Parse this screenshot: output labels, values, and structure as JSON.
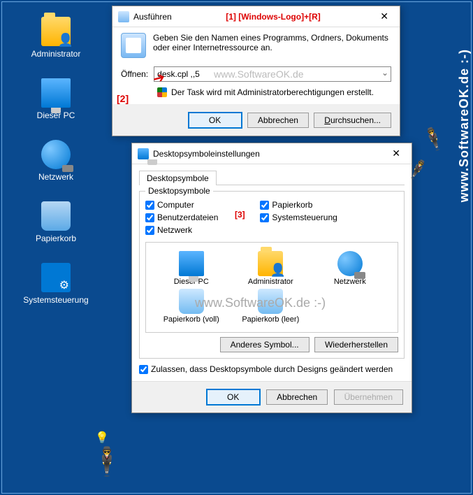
{
  "desktop": {
    "icons": [
      {
        "label": "Administrator",
        "ic": "ic-folder"
      },
      {
        "label": "Dieser PC",
        "ic": "ic-pc"
      },
      {
        "label": "Netzwerk",
        "ic": "ic-net"
      },
      {
        "label": "Papierkorb",
        "ic": "ic-bin"
      },
      {
        "label": "Systemsteuerung",
        "ic": "ic-ctrl"
      }
    ]
  },
  "run": {
    "title": "Ausführen",
    "annot1": "[1] [Windows-Logo]+[R]",
    "desc": "Geben Sie den Namen eines Programms, Ordners, Dokuments oder einer Internetressource an.",
    "open_label": "Öffnen:",
    "command": "desk.cpl ,,5",
    "input_wm": "www.SoftwareOK.de",
    "admin_note": "Der Task wird mit Administratorberechtigungen erstellt.",
    "annot2": "[2]",
    "ok": "OK",
    "cancel": "Abbrechen",
    "browse": "Durchsuchen..."
  },
  "settings": {
    "title": "Desktopsymboleinstellungen",
    "tab": "Desktopsymbole",
    "group_title": "Desktopsymbole",
    "annot3": "[3]",
    "checks_left": [
      "Computer",
      "Benutzerdateien",
      "Netzwerk"
    ],
    "checks_right": [
      "Papierkorb",
      "Systemsteuerung"
    ],
    "preview": [
      {
        "label": "Dieser PC",
        "ic": "ic-pc"
      },
      {
        "label": "Administrator",
        "ic": "ic-folder"
      },
      {
        "label": "Netzwerk",
        "ic": "ic-net"
      },
      {
        "label": "Papierkorb (voll)",
        "ic": "ic-bin"
      },
      {
        "label": "Papierkorb (leer)",
        "ic": "ic-bin"
      }
    ],
    "wm": "www.SoftwareOK.de :-)",
    "other_symbol": "Anderes Symbol...",
    "restore": "Wiederherstellen",
    "allow_themes": "Zulassen, dass Desktopsymbole durch Designs geändert werden",
    "ok": "OK",
    "cancel": "Abbrechen",
    "apply": "Übernehmen"
  },
  "side_wm": "www.SoftwareOK.de :-)"
}
